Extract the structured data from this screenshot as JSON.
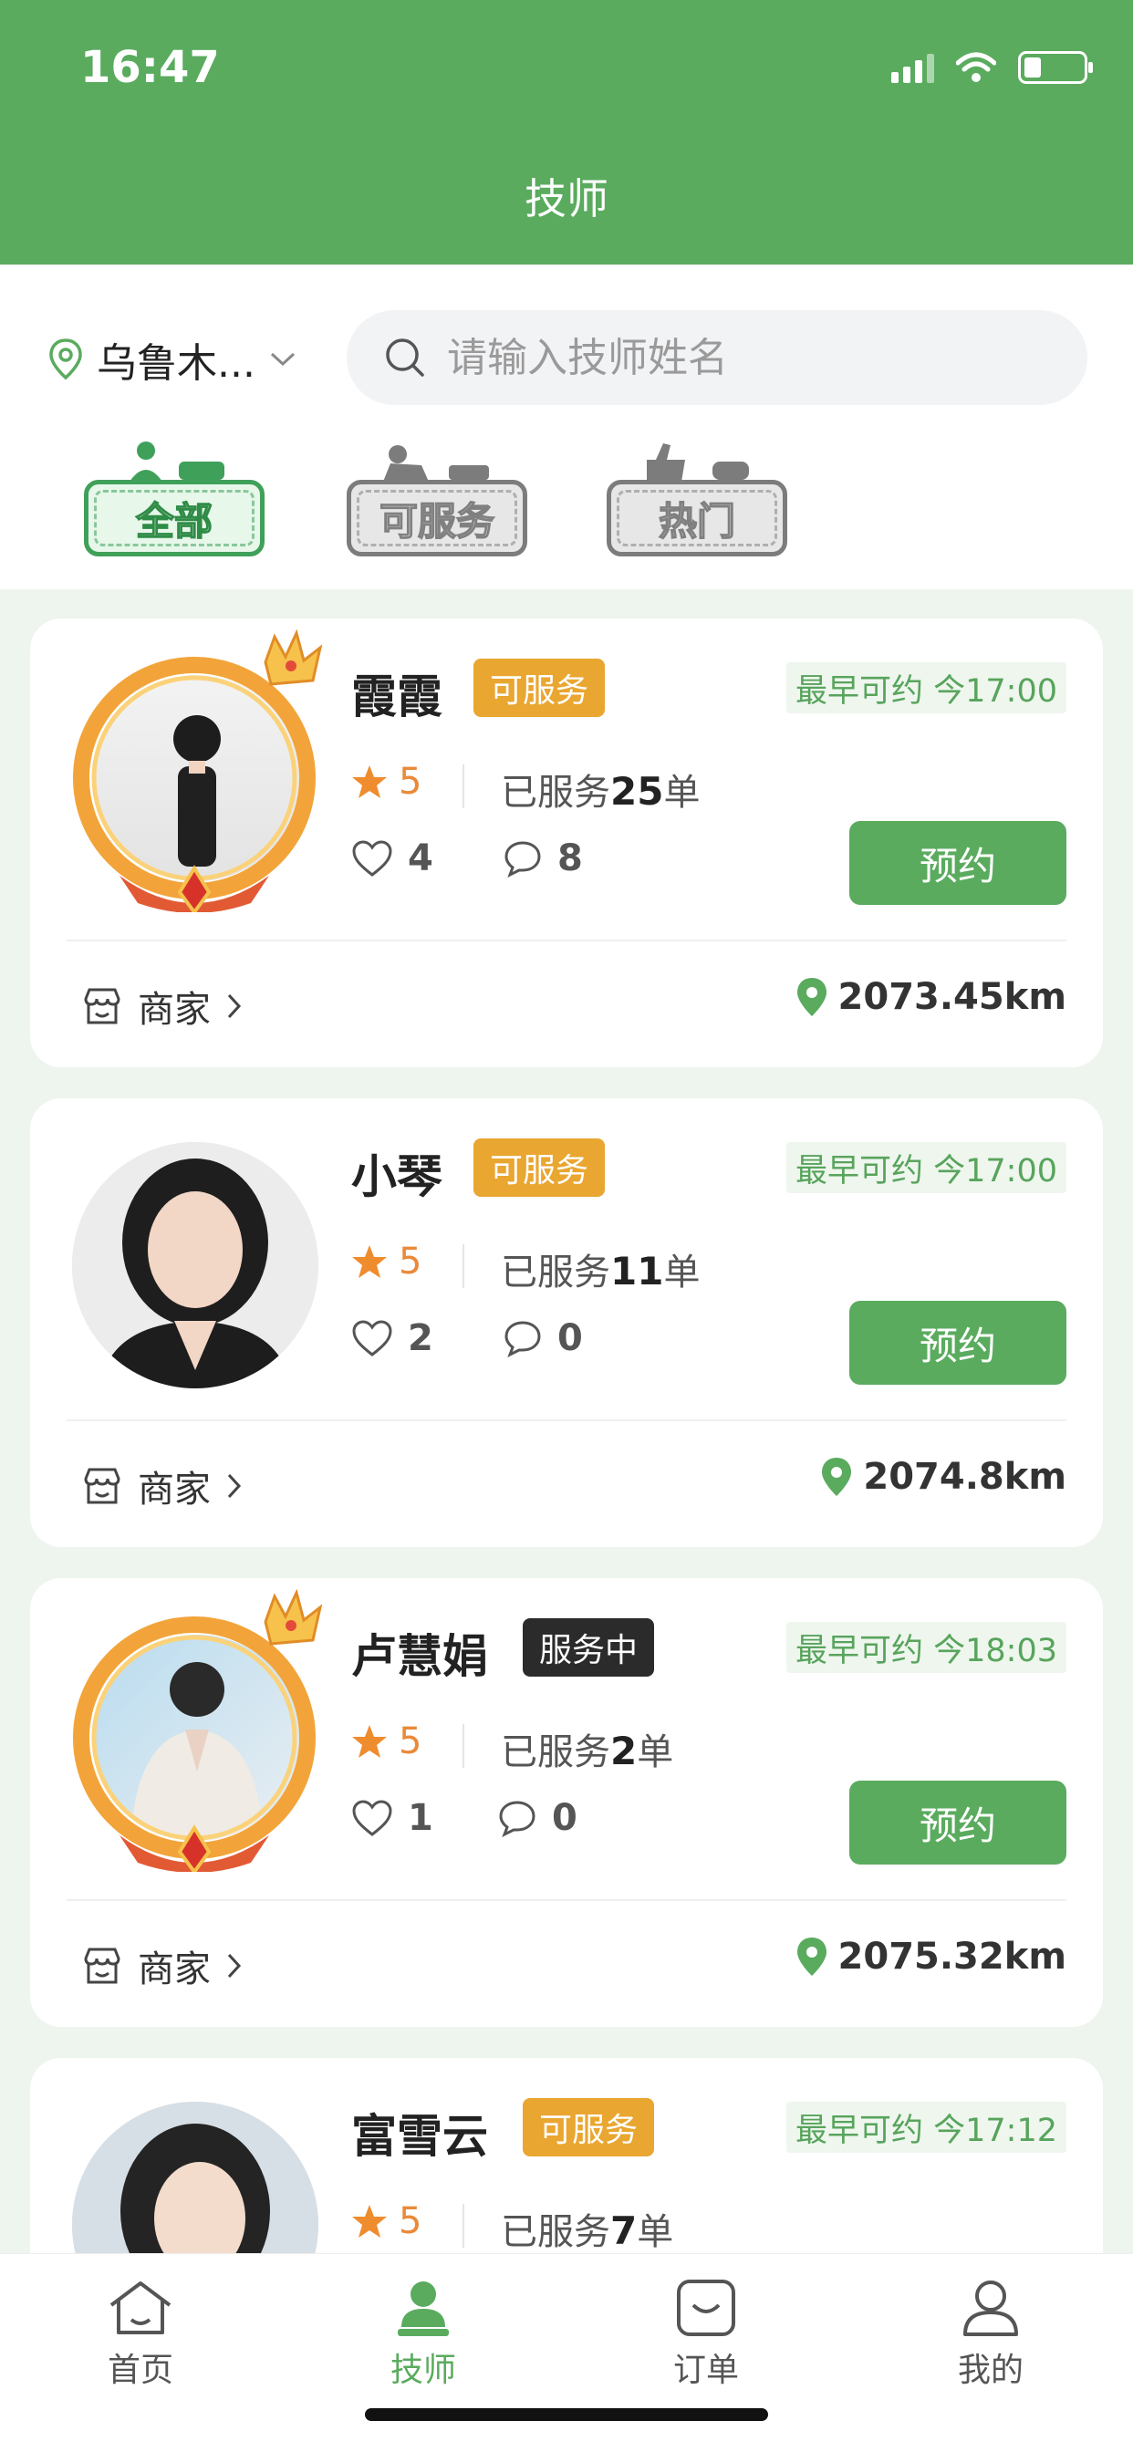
{
  "status_bar": {
    "time": "16:47"
  },
  "header": {
    "title": "技师"
  },
  "location": {
    "city": "乌鲁木..."
  },
  "search": {
    "placeholder": "请输入技师姓名"
  },
  "filters": [
    {
      "label": "全部",
      "active": true
    },
    {
      "label": "可服务",
      "active": false
    },
    {
      "label": "热门",
      "active": false
    }
  ],
  "technicians": [
    {
      "name": "霞霞",
      "status": "可服务",
      "earliest": "最早可约 今17:00",
      "rating": "5",
      "served_prefix": "已服务",
      "served_count": "25",
      "served_suffix": "单",
      "likes": "4",
      "comments": "8",
      "book_label": "预约",
      "merchant_label": "商家",
      "distance": "2073.45km"
    },
    {
      "name": "小琴",
      "status": "可服务",
      "earliest": "最早可约 今17:00",
      "rating": "5",
      "served_prefix": "已服务",
      "served_count": "11",
      "served_suffix": "单",
      "likes": "2",
      "comments": "0",
      "book_label": "预约",
      "merchant_label": "商家",
      "distance": "2074.8km"
    },
    {
      "name": "卢慧娟",
      "status": "服务中",
      "earliest": "最早可约 今18:03",
      "rating": "5",
      "served_prefix": "已服务",
      "served_count": "2",
      "served_suffix": "单",
      "likes": "1",
      "comments": "0",
      "book_label": "预约",
      "merchant_label": "商家",
      "distance": "2075.32km"
    },
    {
      "name": "富雪云",
      "status": "可服务",
      "earliest": "最早可约 今17:12",
      "rating": "5",
      "served_prefix": "已服务",
      "served_count": "7",
      "served_suffix": "单"
    }
  ],
  "tabbar": [
    {
      "label": "首页",
      "active": false
    },
    {
      "label": "技师",
      "active": true
    },
    {
      "label": "订单",
      "active": false
    },
    {
      "label": "我的",
      "active": false
    }
  ],
  "colors": {
    "primary": "#5aab5e",
    "badge_available": "#e9a630",
    "badge_busy": "#2b2b2b",
    "rating": "#e98a3a"
  }
}
